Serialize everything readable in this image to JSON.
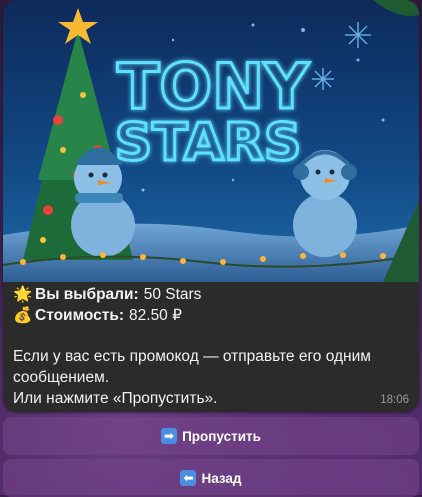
{
  "message": {
    "banner_title_line1": "TONY",
    "banner_title_line2": "STARS",
    "selected_emoji": "🌟",
    "selected_label": "Вы выбрали:",
    "selected_value": "50 Stars",
    "cost_emoji": "💰",
    "cost_label": "Стоимость:",
    "cost_value": "82.50 ₽",
    "promo_line1": "Если у вас есть промокод — отправьте его одним",
    "promo_line2": "сообщением.",
    "promo_line3": "Или нажмите «Пропустить».",
    "time": "18:06"
  },
  "keyboard": {
    "skip_icon": "➡",
    "skip_label": "Пропустить",
    "back_icon": "⬅",
    "back_label": "Назад"
  },
  "colors": {
    "bubble": "#2b2b2b",
    "neon": "#5fe0ff",
    "button": "#7a468c"
  }
}
